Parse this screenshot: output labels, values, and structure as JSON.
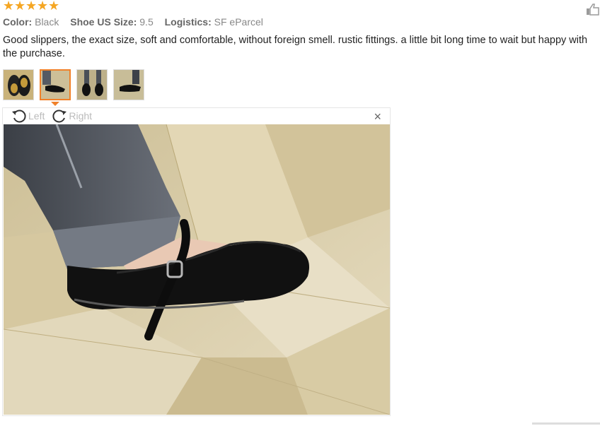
{
  "rating": {
    "stars": 5,
    "star_glyph": "★"
  },
  "attributes": [
    {
      "key": "Color:",
      "value": "Black"
    },
    {
      "key": "Shoe US Size:",
      "value": "9.5"
    },
    {
      "key": "Logistics:",
      "value": "SF eParcel"
    }
  ],
  "review_text": "Good slippers, the exact size, soft and comfortable, without foreign smell. rustic fittings. a little bit long time to wait but happy with the purchase.",
  "thumbnails": [
    {
      "icon": "shoe-soles-photo"
    },
    {
      "icon": "shoe-on-foot-photo",
      "active": true
    },
    {
      "icon": "shoes-pair-photo"
    },
    {
      "icon": "shoes-worn-photo"
    }
  ],
  "viewer": {
    "rotate_left_label": "Left",
    "rotate_right_label": "Right",
    "close_glyph": "×"
  },
  "colors": {
    "accent": "#f0812a",
    "star": "#f5a623"
  }
}
